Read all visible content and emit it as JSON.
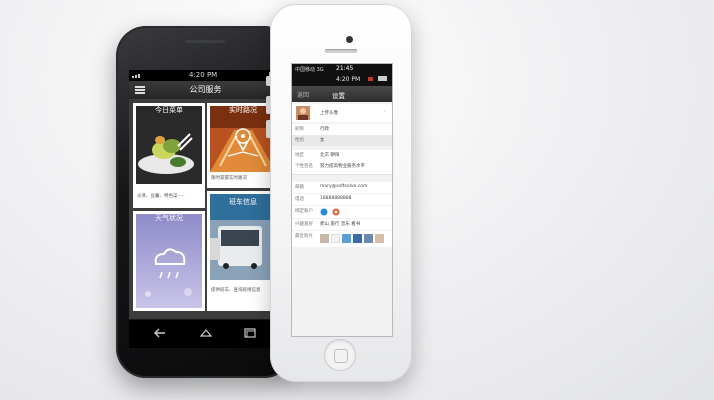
{
  "android": {
    "status_time": "4:20 PM",
    "title": "公司服务",
    "tiles": [
      {
        "head": "今日菜单",
        "caption": "炎蒸、豆薯、特色菜·····"
      },
      {
        "head": "实时路况",
        "caption": "随时掌握实时路况"
      },
      {
        "head": "天气状况",
        "caption": ""
      },
      {
        "head": "班车信息",
        "caption": "提供班车、查询班线信息"
      }
    ]
  },
  "iphone": {
    "carrier": "中国移动 3G",
    "time_top": "21:45",
    "time_status": "4:20 PM",
    "nav_back": "返回",
    "nav_title": "设置",
    "avatar_label": "上传头像",
    "rows": [
      {
        "label": "昵称",
        "value": "行政"
      },
      {
        "label": "性别",
        "value": "女"
      },
      {
        "label": "地区",
        "value": "北京 朝阳"
      },
      {
        "label": "个性签名",
        "value": "努力提高物业服务水平"
      },
      {
        "label": "邮箱",
        "value": "mary@softsolve.com"
      },
      {
        "label": "电话",
        "value": "18888888888"
      },
      {
        "label": "绑定账户",
        "value": ""
      },
      {
        "label": "兴趣爱好",
        "value": "爬山 旅行 音乐 看书"
      },
      {
        "label": "最近照片",
        "value": ""
      }
    ]
  }
}
